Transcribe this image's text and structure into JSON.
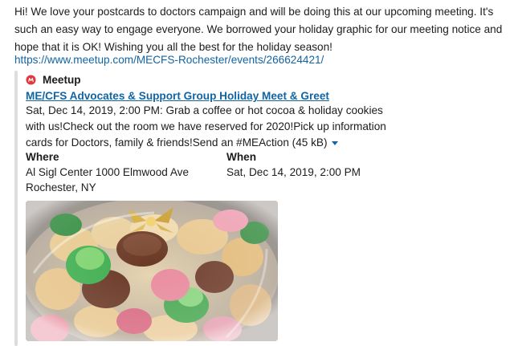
{
  "message": {
    "text": "Hi! We love your postcards to doctors campaign and will be doing this at our upcoming meeting. It's such an easy way to engage everyone. We borrowed your holiday graphic for our meeting notice and hope that it is OK! Wishing you all the best for the holiday season!",
    "link": "https://www.meetup.com/MECFS-Rochester/events/266624421/"
  },
  "unfurl": {
    "site_icon": "meetup-logo-icon",
    "site_name": "Meetup",
    "title": "ME/CFS Advocates & Support Group Holiday Meet & Greet",
    "description": "Sat, Dec 14, 2019, 2:00 PM: Grab a coffee or hot cocoa & holiday cookies with us!Check out the room we have reserved for 2020!Pick up information cards for Doctors, family & friends!Send an #MEAction (45 kB)",
    "where_label": "Where",
    "where_line1": "Al Sigl Center 1000 Elmwood Ave",
    "where_line2": "Rochester, NY",
    "when_label": "When",
    "when_value": "Sat, Dec 14, 2019, 2:00 PM",
    "expand_icon": "caret-down-icon",
    "image_icon": "holiday-cookie-tray-image"
  },
  "colors": {
    "link": "#1264a3",
    "meetup_red": "#e0393e",
    "bar": "#dddddd"
  }
}
